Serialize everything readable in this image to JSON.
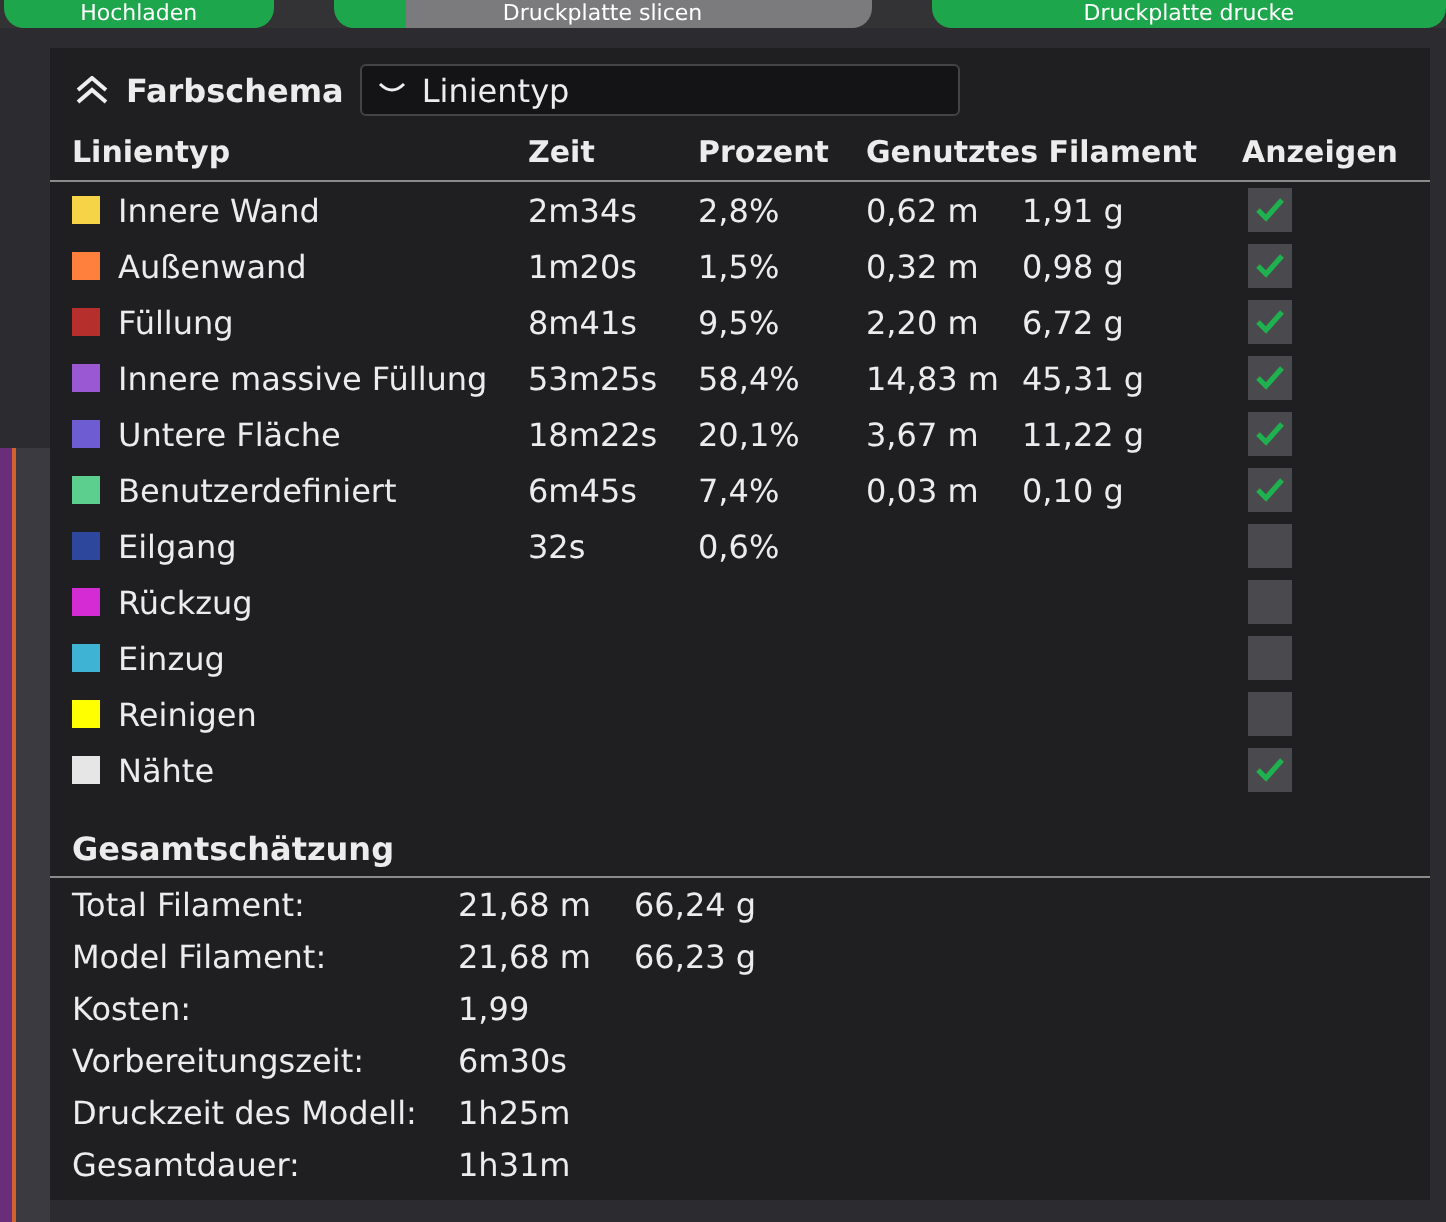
{
  "toolbar": {
    "buttons": [
      {
        "label": "Hochladen",
        "kind": "green"
      },
      {
        "label": "Druckplatte slicen",
        "kind": "grey"
      },
      {
        "label": "Druckplatte drucke",
        "kind": "green"
      }
    ]
  },
  "panel": {
    "title": "Farbschema",
    "scheme_dropdown": {
      "value": "Linientyp"
    },
    "columns": [
      "Linientyp",
      "Zeit",
      "Prozent",
      "Genutztes Filament",
      "Anzeigen"
    ],
    "rows": [
      {
        "name": "Innere Wand",
        "color": "#f5d547",
        "time": "2m34s",
        "percent": "2,8%",
        "length": "0,62 m",
        "weight": "1,91 g",
        "checked": true
      },
      {
        "name": "Außenwand",
        "color": "#ff7f3c",
        "time": "1m20s",
        "percent": "1,5%",
        "length": "0,32 m",
        "weight": "0,98 g",
        "checked": true
      },
      {
        "name": "Füllung",
        "color": "#b5302c",
        "time": "8m41s",
        "percent": "9,5%",
        "length": "2,20 m",
        "weight": "6,72 g",
        "checked": true
      },
      {
        "name": "Innere massive Füllung",
        "color": "#9a58d2",
        "time": "53m25s",
        "percent": "58,4%",
        "length": "14,83 m",
        "weight": "45,31 g",
        "checked": true
      },
      {
        "name": "Untere Fläche",
        "color": "#6e5cd3",
        "time": "18m22s",
        "percent": "20,1%",
        "length": "3,67 m",
        "weight": "11,22 g",
        "checked": true
      },
      {
        "name": "Benutzerdefiniert",
        "color": "#5ccf8e",
        "time": "6m45s",
        "percent": "7,4%",
        "length": "0,03 m",
        "weight": "0,10 g",
        "checked": true
      },
      {
        "name": "Eilgang",
        "color": "#2d479d",
        "time": "32s",
        "percent": "0,6%",
        "checked": false
      },
      {
        "name": "Rückzug",
        "color": "#d42cd4",
        "checked": false
      },
      {
        "name": "Einzug",
        "color": "#3eb3d3",
        "checked": false
      },
      {
        "name": "Reinigen",
        "color": "#ffff00",
        "checked": false
      },
      {
        "name": "Nähte",
        "color": "#e6e6e6",
        "checked": true
      }
    ],
    "summary_title": "Gesamtschätzung",
    "summary": [
      {
        "label": "Total Filament:",
        "value": "21,68 m",
        "value_2": "66,24 g"
      },
      {
        "label": "Model Filament:",
        "value": "21,68 m",
        "value_2": "66,23 g"
      },
      {
        "label": "Kosten:",
        "value": "1,99"
      },
      {
        "label": "Vorbereitungszeit:",
        "value": "6m30s"
      },
      {
        "label": "Druckzeit des Modell:",
        "value": "1h25m"
      },
      {
        "label": "Gesamtdauer:",
        "value": "1h31m"
      }
    ]
  }
}
